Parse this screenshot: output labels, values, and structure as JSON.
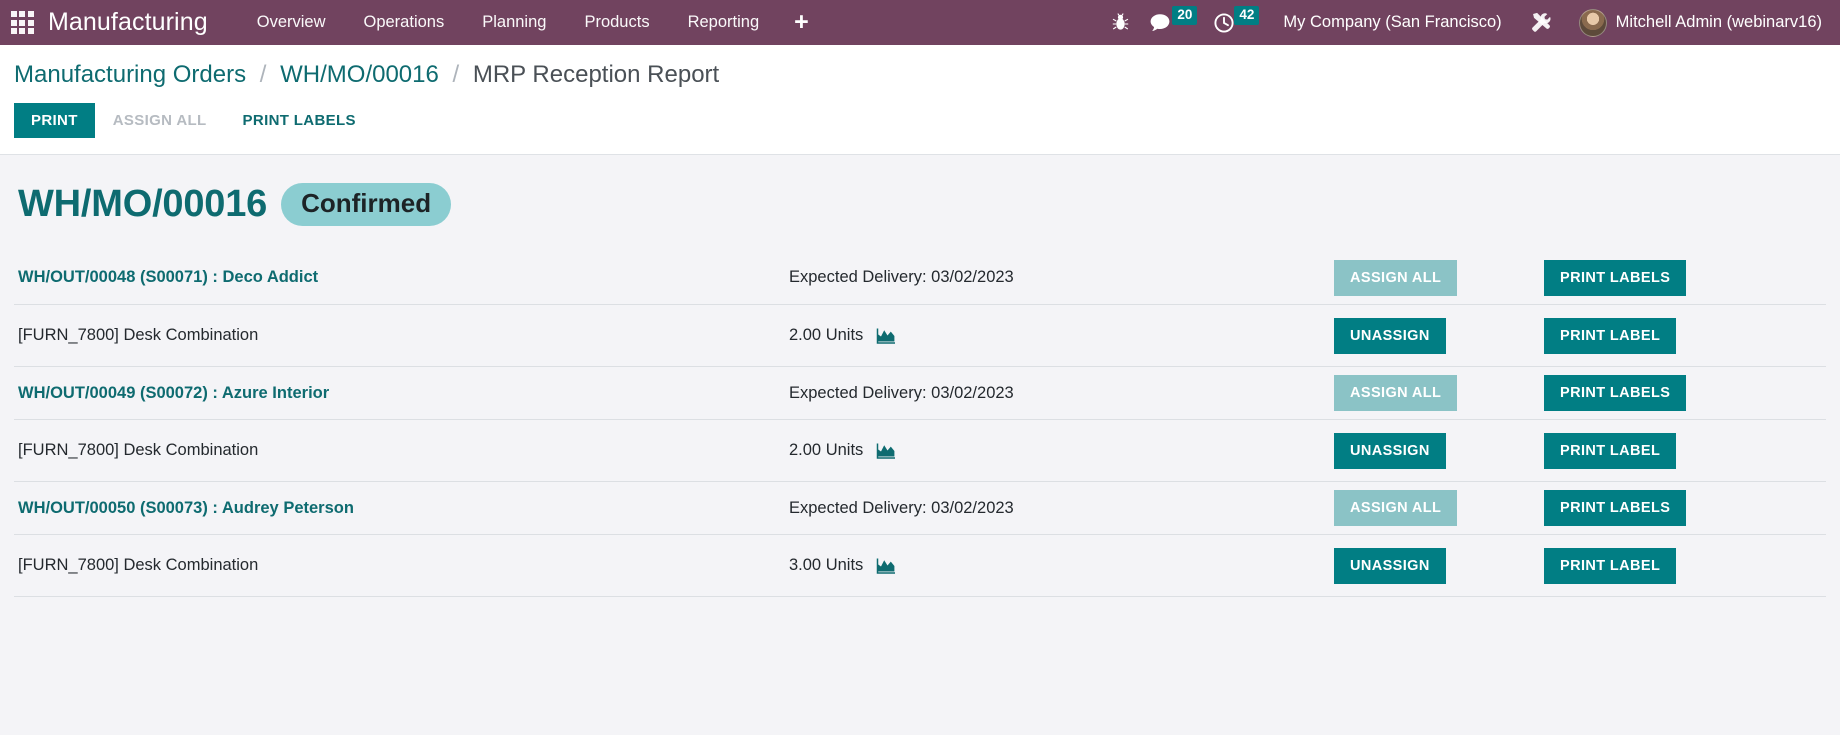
{
  "navbar": {
    "apps_icon": "apps-grid-icon",
    "brand": "Manufacturing",
    "menu": [
      {
        "label": "Overview"
      },
      {
        "label": "Operations"
      },
      {
        "label": "Planning"
      },
      {
        "label": "Products"
      },
      {
        "label": "Reporting"
      }
    ],
    "plus_label": "+",
    "debug_icon": "bug-icon",
    "messages": {
      "icon": "chat-bubble-icon",
      "count": "20"
    },
    "activities": {
      "icon": "clock-icon",
      "count": "42"
    },
    "company": "My Company (San Francisco)",
    "tools_icon": "wrench-screwdriver-icon",
    "avatar_icon": "user-avatar",
    "user": "Mitchell Admin (webinarv16)",
    "colors": {
      "background": "#71435f",
      "badge": "#017e84"
    }
  },
  "breadcrumb": {
    "items": [
      {
        "label": "Manufacturing Orders",
        "link": true
      },
      {
        "label": "WH/MO/00016",
        "link": true
      },
      {
        "label": "MRP Reception Report",
        "link": false
      }
    ],
    "separator": "/"
  },
  "action_bar": {
    "print": "PRINT",
    "assign_all": "ASSIGN ALL",
    "print_labels": "PRINT LABELS"
  },
  "document": {
    "title": "WH/MO/00016",
    "status": "Confirmed",
    "status_color": "#8bcdd1",
    "title_color": "#0e6b70"
  },
  "table": {
    "groups": [
      {
        "picking": "WH/OUT/00048 (S00071) : Deco Addict",
        "expected_delivery": "Expected Delivery: 03/02/2023",
        "assign_all": "ASSIGN ALL",
        "print_labels": "PRINT LABELS",
        "lines": [
          {
            "product": "[FURN_7800] Desk Combination",
            "quantity": "2.00 Units",
            "chart_icon": "area-chart-icon",
            "unassign": "UNASSIGN",
            "print_label": "PRINT LABEL"
          }
        ]
      },
      {
        "picking": "WH/OUT/00049 (S00072) : Azure Interior",
        "expected_delivery": "Expected Delivery: 03/02/2023",
        "assign_all": "ASSIGN ALL",
        "print_labels": "PRINT LABELS",
        "lines": [
          {
            "product": "[FURN_7800] Desk Combination",
            "quantity": "2.00 Units",
            "chart_icon": "area-chart-icon",
            "unassign": "UNASSIGN",
            "print_label": "PRINT LABEL"
          }
        ]
      },
      {
        "picking": "WH/OUT/00050 (S00073) : Audrey Peterson",
        "expected_delivery": "Expected Delivery: 03/02/2023",
        "assign_all": "ASSIGN ALL",
        "print_labels": "PRINT LABELS",
        "lines": [
          {
            "product": "[FURN_7800] Desk Combination",
            "quantity": "3.00 Units",
            "chart_icon": "area-chart-icon",
            "unassign": "UNASSIGN",
            "print_label": "PRINT LABEL"
          }
        ]
      }
    ]
  }
}
